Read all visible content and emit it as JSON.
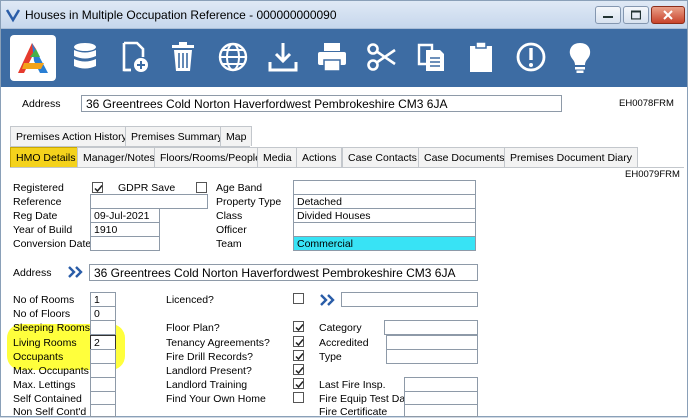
{
  "window": {
    "title": "Houses in Multiple Occupation Reference - 000000000090",
    "colors": {
      "toolbar": "#3d6ca3",
      "active_tab": "#f4d21c",
      "team_field": "#38e3f5",
      "highlight": "#ffff3c"
    }
  },
  "toolbar": {
    "icons": [
      "logo",
      "database-icon",
      "new-document-icon",
      "trash-icon",
      "globe-icon",
      "download-icon",
      "print-icon",
      "scissors-icon",
      "copy-icon",
      "clipboard-icon",
      "alert-icon",
      "lightbulb-icon"
    ]
  },
  "header": {
    "address_label": "Address",
    "address_value": "36 Greentrees Cold Norton Haverfordwest Pembrokeshire CM3 6JA",
    "form_code": "EH0078FRM"
  },
  "tabs_row1": [
    "Premises Action History",
    "Premises Summary",
    "Map"
  ],
  "tabs_row2": [
    "HMO Details",
    "Manager/Notes",
    "Floors/Rooms/People",
    "Media",
    "Actions",
    "Case Contacts",
    "Case Documents",
    "Premises Document Diary"
  ],
  "sub_form_code": "EH0079FRM",
  "details": {
    "registered_label": "Registered",
    "gdpr_label": "GDPR Save",
    "age_band_label": "Age Band",
    "age_band_value": "",
    "reference_label": "Reference",
    "reference_value": "",
    "property_type_label": "Property Type",
    "property_type_value": "Detached",
    "reg_date_label": "Reg Date",
    "reg_date_value": "09-Jul-2021",
    "class_label": "Class",
    "class_value": "Divided Houses",
    "year_built_label": "Year of Build",
    "year_built_value": "1910",
    "officer_label": "Officer",
    "officer_value": "",
    "conversion_date_label": "Conversion Date",
    "conversion_date_value": "",
    "team_label": "Team",
    "team_value": "Commercial",
    "address_label": "Address",
    "address_value": "36 Greentrees Cold Norton Haverfordwest Pembrokeshire CM3 6JA"
  },
  "rooms": {
    "no_rooms_label": "No of Rooms",
    "no_rooms_value": "1",
    "no_floors_label": "No of Floors",
    "no_floors_value": "0",
    "sleeping_label": "Sleeping Rooms",
    "sleeping_value": "",
    "living_label": "Living Rooms",
    "living_value": "2",
    "occupants_label": "Occupants",
    "occupants_value": "",
    "max_occupants_label": "Max. Occupants",
    "max_occupants_value": "",
    "max_lettings_label": "Max. Lettings",
    "max_lettings_value": "",
    "self_contained_label": "Self Contained",
    "self_contained_value": "",
    "non_self_label": "Non Self Cont'd",
    "non_self_value": ""
  },
  "checks": {
    "licenced_label": "Licenced?",
    "floor_plan_label": "Floor Plan?",
    "tenancy_label": "Tenancy Agreements?",
    "fire_drill_label": "Fire Drill Records?",
    "landlord_present_label": "Landlord Present?",
    "landlord_training_label": "Landlord Training",
    "find_home_label": "Find Your Own Home"
  },
  "right": {
    "category_label": "Category",
    "category_value": "",
    "accredited_label": "Accredited",
    "accredited_value": "",
    "type_label": "Type",
    "type_value": "",
    "last_fire_label": "Last Fire Insp.",
    "last_fire_value": "",
    "fire_equip_label": "Fire Equip Test Date",
    "fire_equip_value": "",
    "fire_cert_label": "Fire Certificate",
    "fire_cert_value": ""
  }
}
